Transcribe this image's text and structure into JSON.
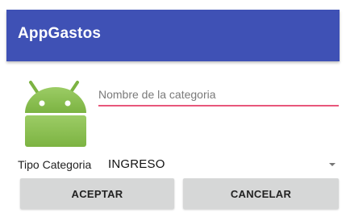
{
  "appbar": {
    "title": "AppGastos"
  },
  "form": {
    "name_placeholder": "Nombre de la categoria",
    "tipo_label": "Tipo Categoria",
    "tipo_selected": "INGRESO"
  },
  "buttons": {
    "accept_label": "ACEPTAR",
    "cancel_label": "CANCELAR"
  },
  "icons": {
    "category_image": "android-robot-icon",
    "spinner_arrow": "dropdown-arrow-icon"
  },
  "colors": {
    "appbar": "#3f51b5",
    "accent_underline": "#e8577b",
    "android_green": "#8bc34a",
    "button_bg": "#d6d7d7"
  }
}
